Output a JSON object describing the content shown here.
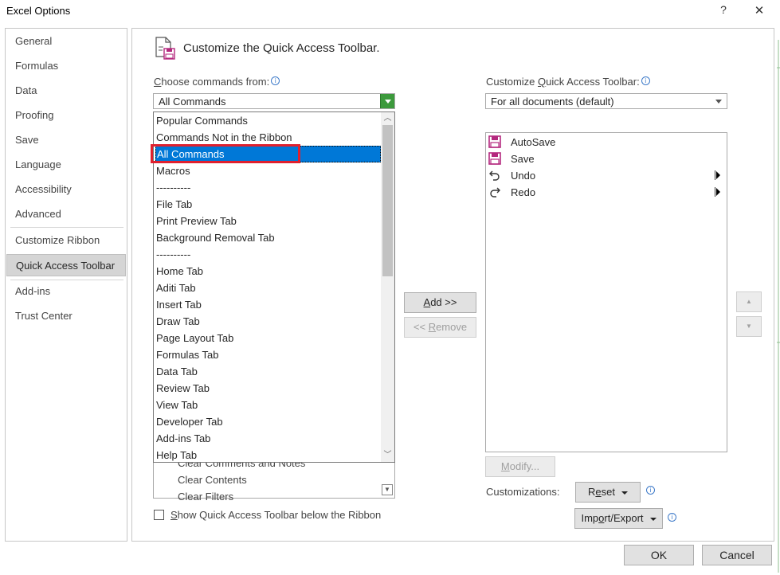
{
  "window": {
    "title": "Excel Options",
    "help_glyph": "?",
    "close_glyph": "✕"
  },
  "nav": {
    "items": [
      {
        "label": "General"
      },
      {
        "label": "Formulas"
      },
      {
        "label": "Data"
      },
      {
        "label": "Proofing"
      },
      {
        "label": "Save"
      },
      {
        "label": "Language"
      },
      {
        "label": "Accessibility"
      },
      {
        "label": "Advanced"
      },
      {
        "label": "Customize Ribbon"
      },
      {
        "label": "Quick Access Toolbar"
      },
      {
        "label": "Add-ins"
      },
      {
        "label": "Trust Center"
      }
    ],
    "selected": "Quick Access Toolbar"
  },
  "page": {
    "heading": "Customize the Quick Access Toolbar.",
    "heading_icon": "toolbar-customize-icon"
  },
  "choose": {
    "label_first": "C",
    "label_rest": "hoose commands from:",
    "value": "All Commands",
    "dropdown_items": [
      "Popular Commands",
      "Commands Not in the Ribbon",
      "All Commands",
      "Macros",
      "----------",
      "File Tab",
      "Print Preview Tab",
      "Background Removal Tab",
      "----------",
      "Home Tab",
      "Aditi Tab",
      "Insert Tab",
      "Draw Tab",
      "Page Layout Tab",
      "Formulas Tab",
      "Data Tab",
      "Review Tab",
      "View Tab",
      "Developer Tab",
      "Add-ins Tab",
      "Help Tab"
    ],
    "highlighted": "All Commands",
    "behind_list": [
      "Clear Comments and Notes",
      "Clear Contents",
      "Clear Filters"
    ]
  },
  "customize": {
    "label_prefix": "Customize ",
    "label_underlined": "Q",
    "label_rest": "uick Access Toolbar:",
    "value": "For all documents (default)",
    "items": [
      {
        "label": "AutoSave",
        "icon": "save-disk-icon",
        "submenu": false
      },
      {
        "label": "Save",
        "icon": "save-disk-icon",
        "submenu": false
      },
      {
        "label": "Undo",
        "icon": "undo-arrow-icon",
        "submenu": true
      },
      {
        "label": "Redo",
        "icon": "redo-arrow-icon",
        "submenu": true
      }
    ]
  },
  "buttons": {
    "add_u": "A",
    "add_rest": "dd >>",
    "remove_pre": "<< ",
    "remove_u": "R",
    "remove_rest": "emove",
    "modify_u": "M",
    "modify_rest": "odify...",
    "reset_pre": "R",
    "reset_u": "e",
    "reset_rest": "set",
    "import_pre": "Imp",
    "import_u": "o",
    "import_rest": "rt/Export",
    "ok": "OK",
    "cancel": "Cancel",
    "move_up": "▲",
    "move_down": "▼"
  },
  "customizations_label": "Customizations:",
  "show_below": {
    "u": "S",
    "rest": "how Quick Access Toolbar below the Ribbon",
    "checked": false
  },
  "colors": {
    "accent_blue": "#0078d7",
    "highlight_red": "#e0202e",
    "dropdown_green": "#3c9a3c",
    "save_icon_magenta": "#b4287e"
  }
}
